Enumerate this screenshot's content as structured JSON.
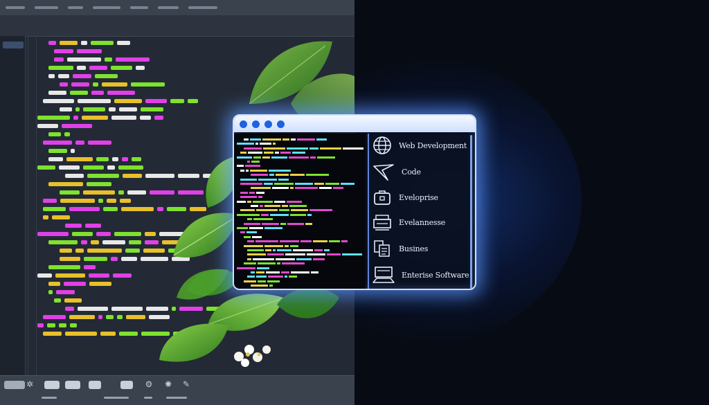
{
  "colors": {
    "background": "#070b14",
    "editor_bg": "#232a35",
    "token_pink": "#e040e8",
    "token_green": "#7ee22e",
    "token_yellow": "#e8c02a",
    "token_white": "#e8e8e8",
    "glow_blue": "#3a7cff",
    "window_border": "#cfe0ff"
  },
  "window": {
    "dots": [
      "dot-1",
      "dot-2",
      "dot-3",
      "dot-4"
    ],
    "menu": [
      {
        "label": "Web Development",
        "icon": "globe-icon"
      },
      {
        "label": "Code",
        "icon": "cursor-pointer-icon"
      },
      {
        "label": "Eveloprise",
        "icon": "briefcase-icon"
      },
      {
        "label": "Evelannesse",
        "icon": "monitor-icon"
      },
      {
        "label": "Busines",
        "icon": "documents-icon"
      },
      {
        "label": "Enterise Software",
        "icon": "laptop-icon"
      }
    ]
  }
}
